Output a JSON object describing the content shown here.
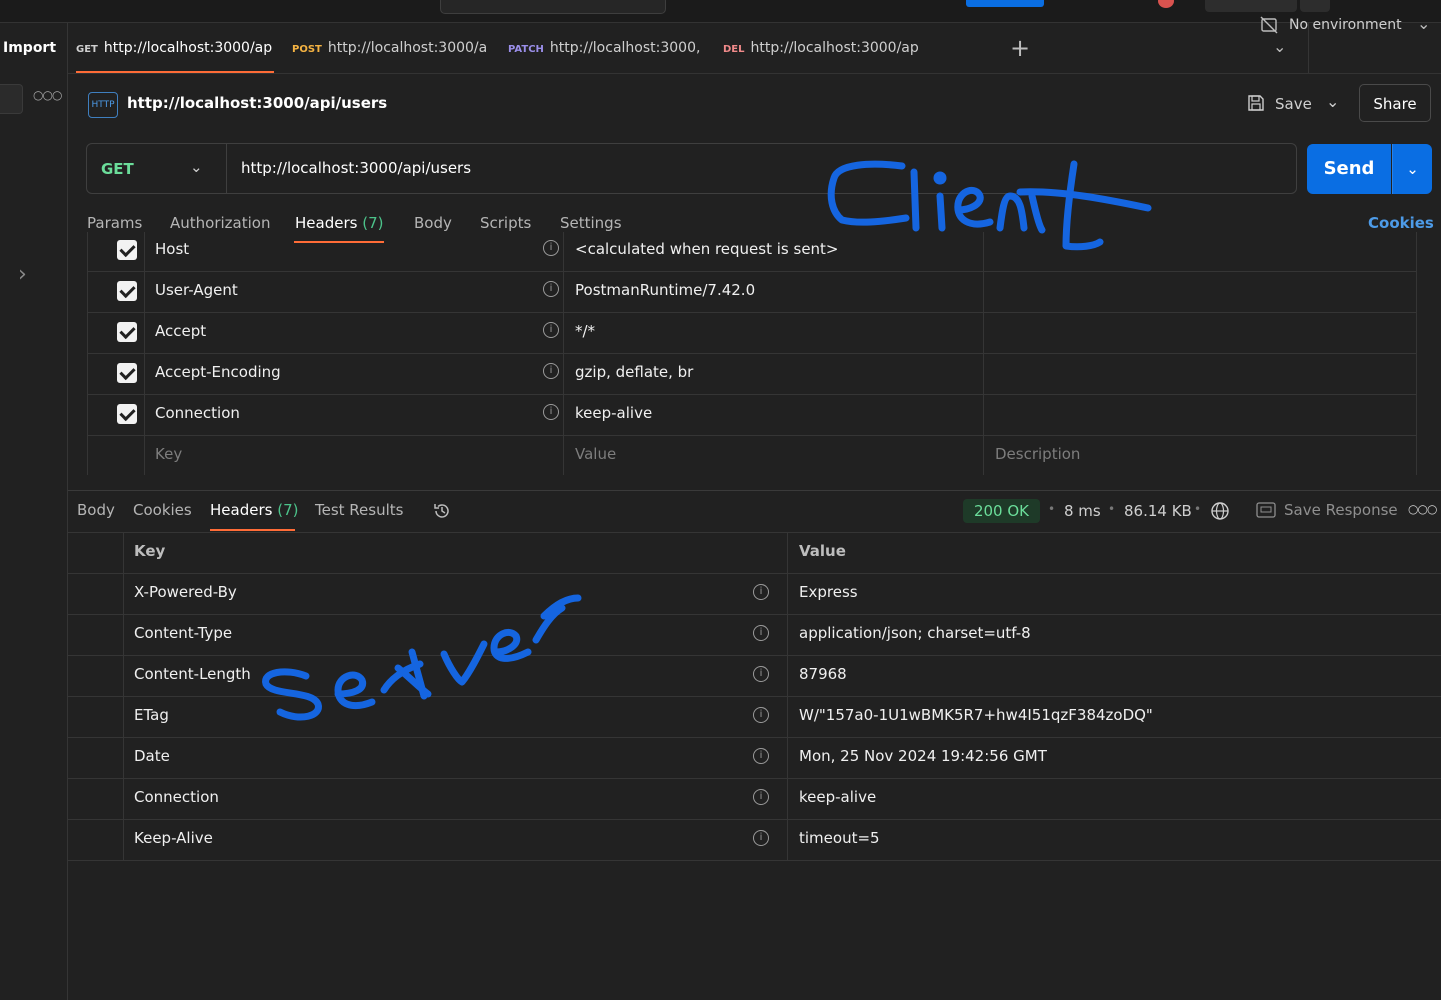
{
  "sidebar": {
    "import_label": "Import"
  },
  "tabs": [
    {
      "method": "GET",
      "method_color": "#cfcfcf",
      "url": "http://localhost:3000/ap",
      "active": true
    },
    {
      "method": "POST",
      "method_color": "#f5b342",
      "url": "http://localhost:3000/a",
      "active": false
    },
    {
      "method": "PATCH",
      "method_color": "#9a8ee8",
      "url": "http://localhost:3000,",
      "active": false
    },
    {
      "method": "DEL",
      "method_color": "#f08a8a",
      "url": "http://localhost:3000/ap",
      "active": false
    }
  ],
  "environment": {
    "label": "No environment"
  },
  "request": {
    "title": "http://localhost:3000/api/users",
    "save_label": "Save",
    "share_label": "Share",
    "method": "GET",
    "url": "http://localhost:3000/api/users",
    "send_label": "Send",
    "cookies_label": "Cookies",
    "tabs": {
      "params": "Params",
      "authorization": "Authorization",
      "headers": "Headers",
      "headers_count": "(7)",
      "body": "Body",
      "scripts": "Scripts",
      "settings": "Settings"
    },
    "headers": [
      {
        "key": "Host",
        "value": "<calculated when request is sent>"
      },
      {
        "key": "User-Agent",
        "value": "PostmanRuntime/7.42.0"
      },
      {
        "key": "Accept",
        "value": "*/*"
      },
      {
        "key": "Accept-Encoding",
        "value": "gzip, deflate, br"
      },
      {
        "key": "Connection",
        "value": "keep-alive"
      }
    ],
    "placeholders": {
      "key": "Key",
      "value": "Value",
      "description": "Description"
    }
  },
  "response": {
    "tabs": {
      "body": "Body",
      "cookies": "Cookies",
      "headers": "Headers",
      "headers_count": "(7)",
      "test_results": "Test Results"
    },
    "status": "200 OK",
    "time": "8 ms",
    "size": "86.14 KB",
    "save_response_label": "Save Response",
    "columns": {
      "key": "Key",
      "value": "Value"
    },
    "headers": [
      {
        "key": "X-Powered-By",
        "value": "Express"
      },
      {
        "key": "Content-Type",
        "value": "application/json; charset=utf-8"
      },
      {
        "key": "Content-Length",
        "value": "87968"
      },
      {
        "key": "ETag",
        "value": "W/\"157a0-1U1wBMK5R7+hw4I51qzF384zoDQ\""
      },
      {
        "key": "Date",
        "value": "Mon, 25 Nov 2024 19:42:56 GMT"
      },
      {
        "key": "Connection",
        "value": "keep-alive"
      },
      {
        "key": "Keep-Alive",
        "value": "timeout=5"
      }
    ]
  },
  "annotations": {
    "client": "Client",
    "server": "Server",
    "ink_color": "#1565e0"
  },
  "colors": {
    "accent": "#ff6c37",
    "primary": "#0a6ee3",
    "get_method": "#6bdd9a",
    "status_ok": "#6bdd9a"
  }
}
